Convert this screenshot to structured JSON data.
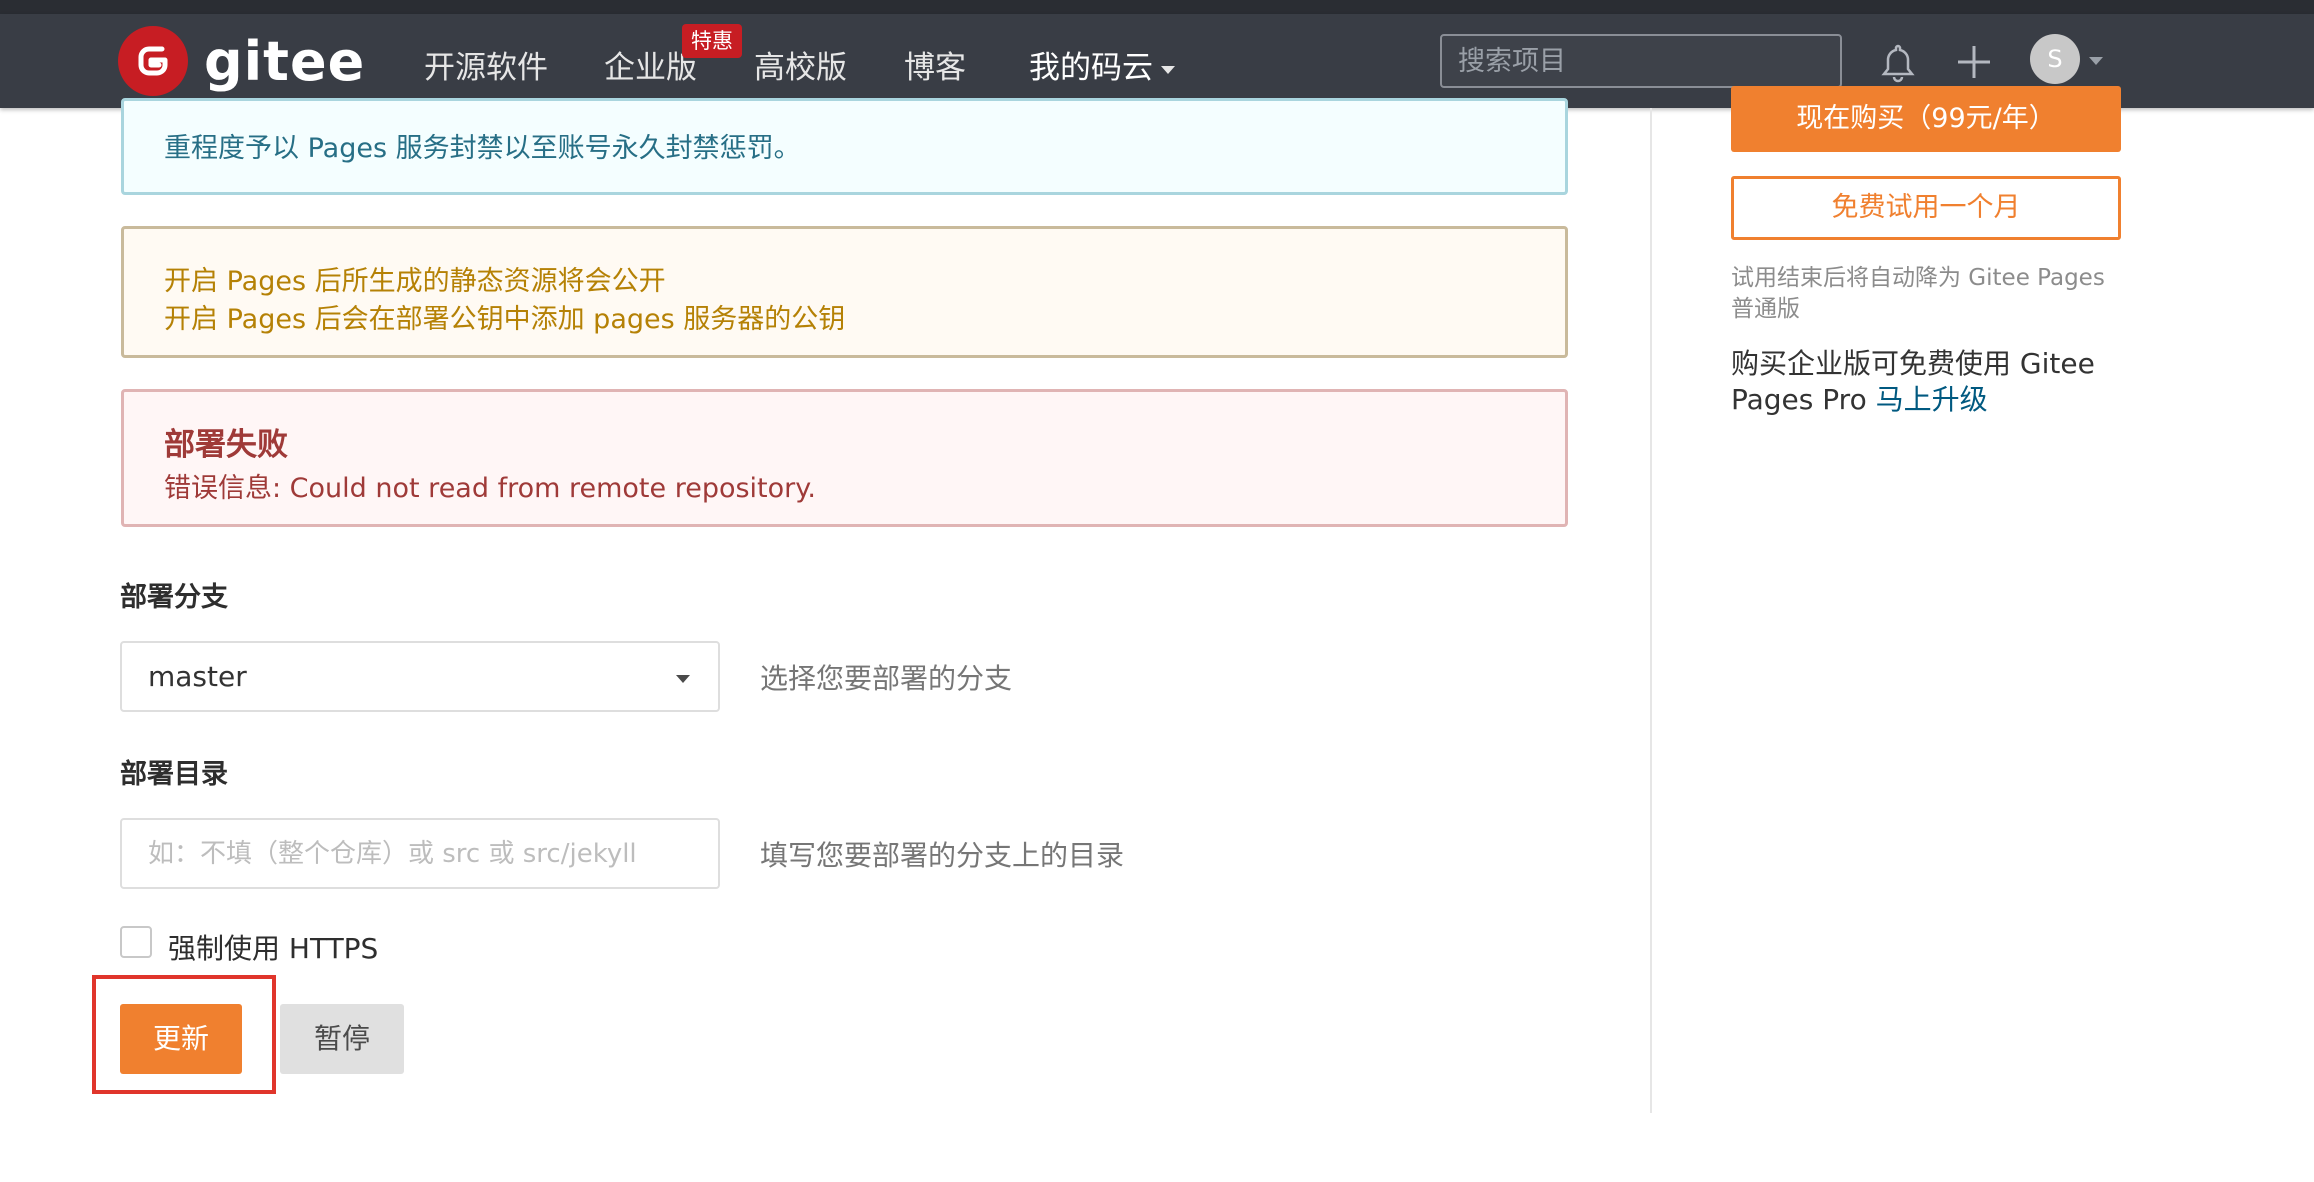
{
  "nav": {
    "brand": "gitee",
    "items": [
      "开源软件",
      "企业版",
      "高校版",
      "博客",
      "我的码云"
    ],
    "badge": "特惠",
    "search_placeholder": "搜索项目",
    "avatar_letter": "S"
  },
  "alerts": {
    "info_line": "重程度予以 Pages 服务封禁以至账号永久封禁惩罚。",
    "warning_lines": [
      "开启 Pages 后所生成的静态资源将会公开",
      "开启 Pages 后会在部署公钥中添加 pages 服务器的公钥"
    ],
    "error_title": "部署失败",
    "error_message": "错误信息: Could not read from remote repository."
  },
  "form": {
    "branch_label": "部署分支",
    "branch_value": "master",
    "branch_hint": "选择您要部署的分支",
    "dir_label": "部署目录",
    "dir_placeholder": "如：不填（整个仓库）或 src 或 src/jekyll",
    "dir_hint": "填写您要部署的分支上的目录",
    "https_label": "强制使用 HTTPS",
    "https_checked": false,
    "update_button": "更新",
    "pause_button": "暂停"
  },
  "sidebar": {
    "buy_button": "现在购买（99元/年）",
    "trial_button": "免费试用一个月",
    "trial_note": "试用结束后将自动降为 Gitee Pages 普通版",
    "upgrade_text": "购买企业版可免费使用 Gitee Pages Pro",
    "upgrade_link": "马上升级"
  },
  "colors": {
    "nav_bg": "#393d45",
    "brand_red": "#c71d23",
    "accent_orange": "#f0802f",
    "highlight_red": "#e0352b"
  }
}
